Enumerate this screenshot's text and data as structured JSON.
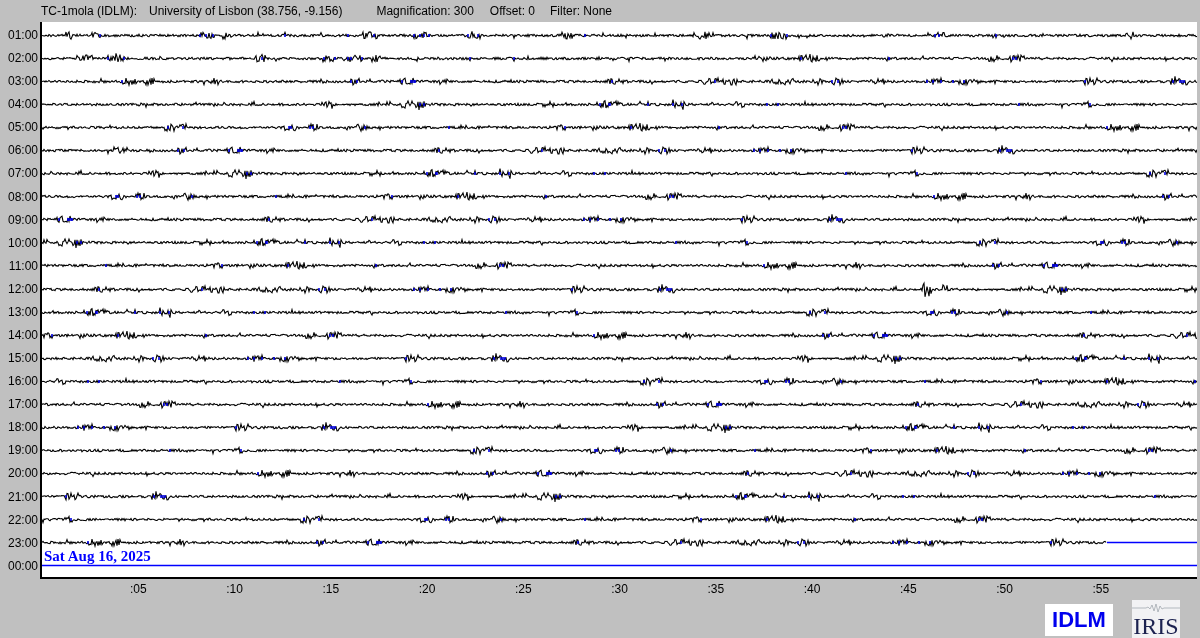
{
  "header": {
    "station": "TC-1mola (IDLM):",
    "location": "University of Lisbon (38.756, -9.156)",
    "magnification": "Magnification: 300",
    "offset": "Offset: 0",
    "filter": "Filter: None"
  },
  "rows": [
    {
      "label": "01:00",
      "kind": "trace"
    },
    {
      "label": "02:00",
      "kind": "trace"
    },
    {
      "label": "03:00",
      "kind": "trace"
    },
    {
      "label": "04:00",
      "kind": "trace"
    },
    {
      "label": "05:00",
      "kind": "trace"
    },
    {
      "label": "06:00",
      "kind": "trace"
    },
    {
      "label": "07:00",
      "kind": "trace"
    },
    {
      "label": "08:00",
      "kind": "trace"
    },
    {
      "label": "09:00",
      "kind": "trace"
    },
    {
      "label": "10:00",
      "kind": "trace"
    },
    {
      "label": "11:00",
      "kind": "trace"
    },
    {
      "label": "12:00",
      "kind": "trace"
    },
    {
      "label": "13:00",
      "kind": "trace"
    },
    {
      "label": "14:00",
      "kind": "trace"
    },
    {
      "label": "15:00",
      "kind": "trace"
    },
    {
      "label": "16:00",
      "kind": "trace"
    },
    {
      "label": "17:00",
      "kind": "trace"
    },
    {
      "label": "18:00",
      "kind": "trace"
    },
    {
      "label": "19:00",
      "kind": "trace"
    },
    {
      "label": "20:00",
      "kind": "trace"
    },
    {
      "label": "21:00",
      "kind": "trace"
    },
    {
      "label": "22:00",
      "kind": "trace"
    },
    {
      "label": "23:00",
      "kind": "current",
      "level": 0.922
    },
    {
      "label": "00:00",
      "kind": "empty",
      "date": "Sat Aug 16, 2025"
    }
  ],
  "x_ticks": [
    ":05",
    ":10",
    ":15",
    ":20",
    ":25",
    ":30",
    ":35",
    ":40",
    ":45",
    ":50",
    ":55"
  ],
  "logos": {
    "station": "IDLM",
    "network": "IRIS"
  }
}
